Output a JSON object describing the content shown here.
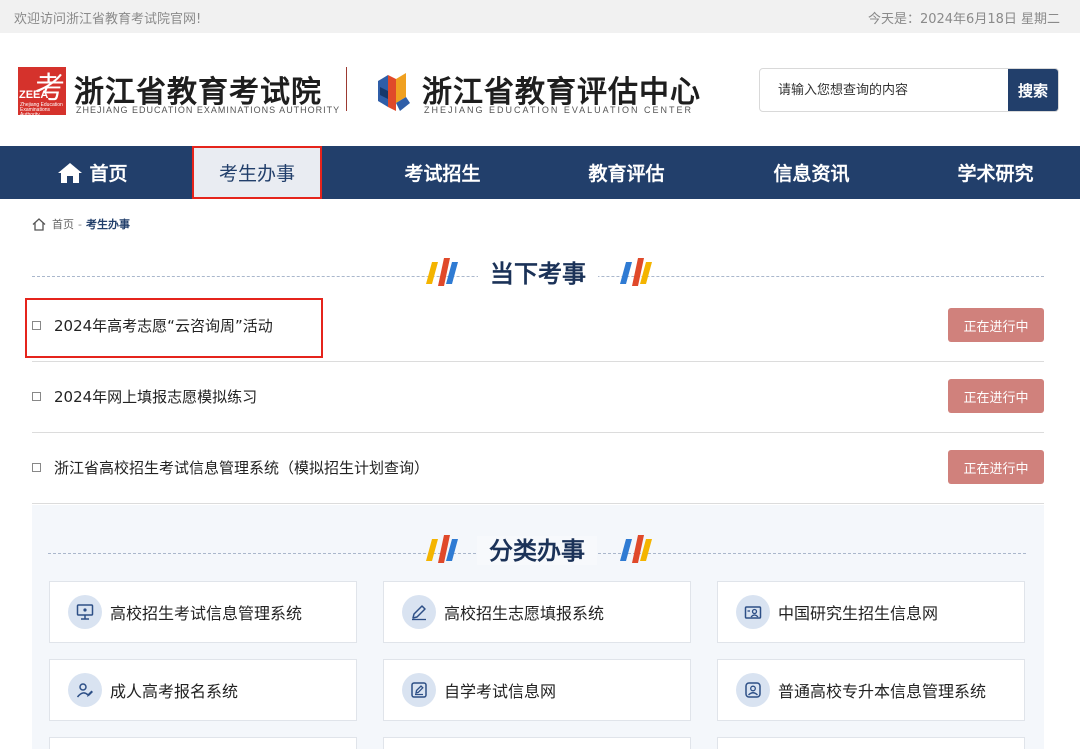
{
  "topbar": {
    "welcome": "欢迎访问浙江省教育考试院官网!",
    "today": "今天是：2024年6月18日 星期二"
  },
  "header": {
    "logo1": {
      "mark_text": "考",
      "abbr": "ZEEA",
      "tiny_text": "Zhejiang Education Examinations Authority",
      "name": "浙江省教育考试院",
      "name_en": "ZHEJIANG EDUCATION EXAMINATIONS AUTHORITY"
    },
    "logo2": {
      "name": "浙江省教育评估中心",
      "name_en": "ZHEJIANG EDUCATION EVALUATION CENTER"
    },
    "search": {
      "placeholder": "请输入您想查询的内容",
      "button": "搜索"
    }
  },
  "nav": {
    "items": [
      {
        "label": "首页",
        "icon": "home-icon"
      },
      {
        "label": "考生办事",
        "active": true
      },
      {
        "label": "考试招生"
      },
      {
        "label": "教育评估"
      },
      {
        "label": "信息资讯"
      },
      {
        "label": "学术研究"
      }
    ]
  },
  "breadcrumb": {
    "home": "首页",
    "separator": "-",
    "current": "考生办事"
  },
  "current_affairs": {
    "title": "当下考事",
    "items": [
      {
        "label": "2024年高考志愿“云咨询周”活动",
        "status": "正在进行中"
      },
      {
        "label": "2024年网上填报志愿模拟练习",
        "status": "正在进行中"
      },
      {
        "label": "浙江省高校招生考试信息管理系统（模拟招生计划查询）",
        "status": "正在进行中"
      }
    ]
  },
  "categories": {
    "title": "分类办事",
    "items": [
      {
        "label": "高校招生考试信息管理系统",
        "icon": "monitor-icon"
      },
      {
        "label": "高校招生志愿填报系统",
        "icon": "pen-icon"
      },
      {
        "label": "中国研究生招生信息网",
        "icon": "id-card-icon"
      },
      {
        "label": "成人高考报名系统",
        "icon": "user-edit-icon"
      },
      {
        "label": "自学考试信息网",
        "icon": "edit-box-icon"
      },
      {
        "label": "普通高校专升本信息管理系统",
        "icon": "user-badge-icon"
      }
    ]
  },
  "colors": {
    "nav_bg": "#223f6b",
    "accent_red": "#e5241c",
    "status_bg": "#d0817c",
    "logo_red": "#d5322c"
  }
}
